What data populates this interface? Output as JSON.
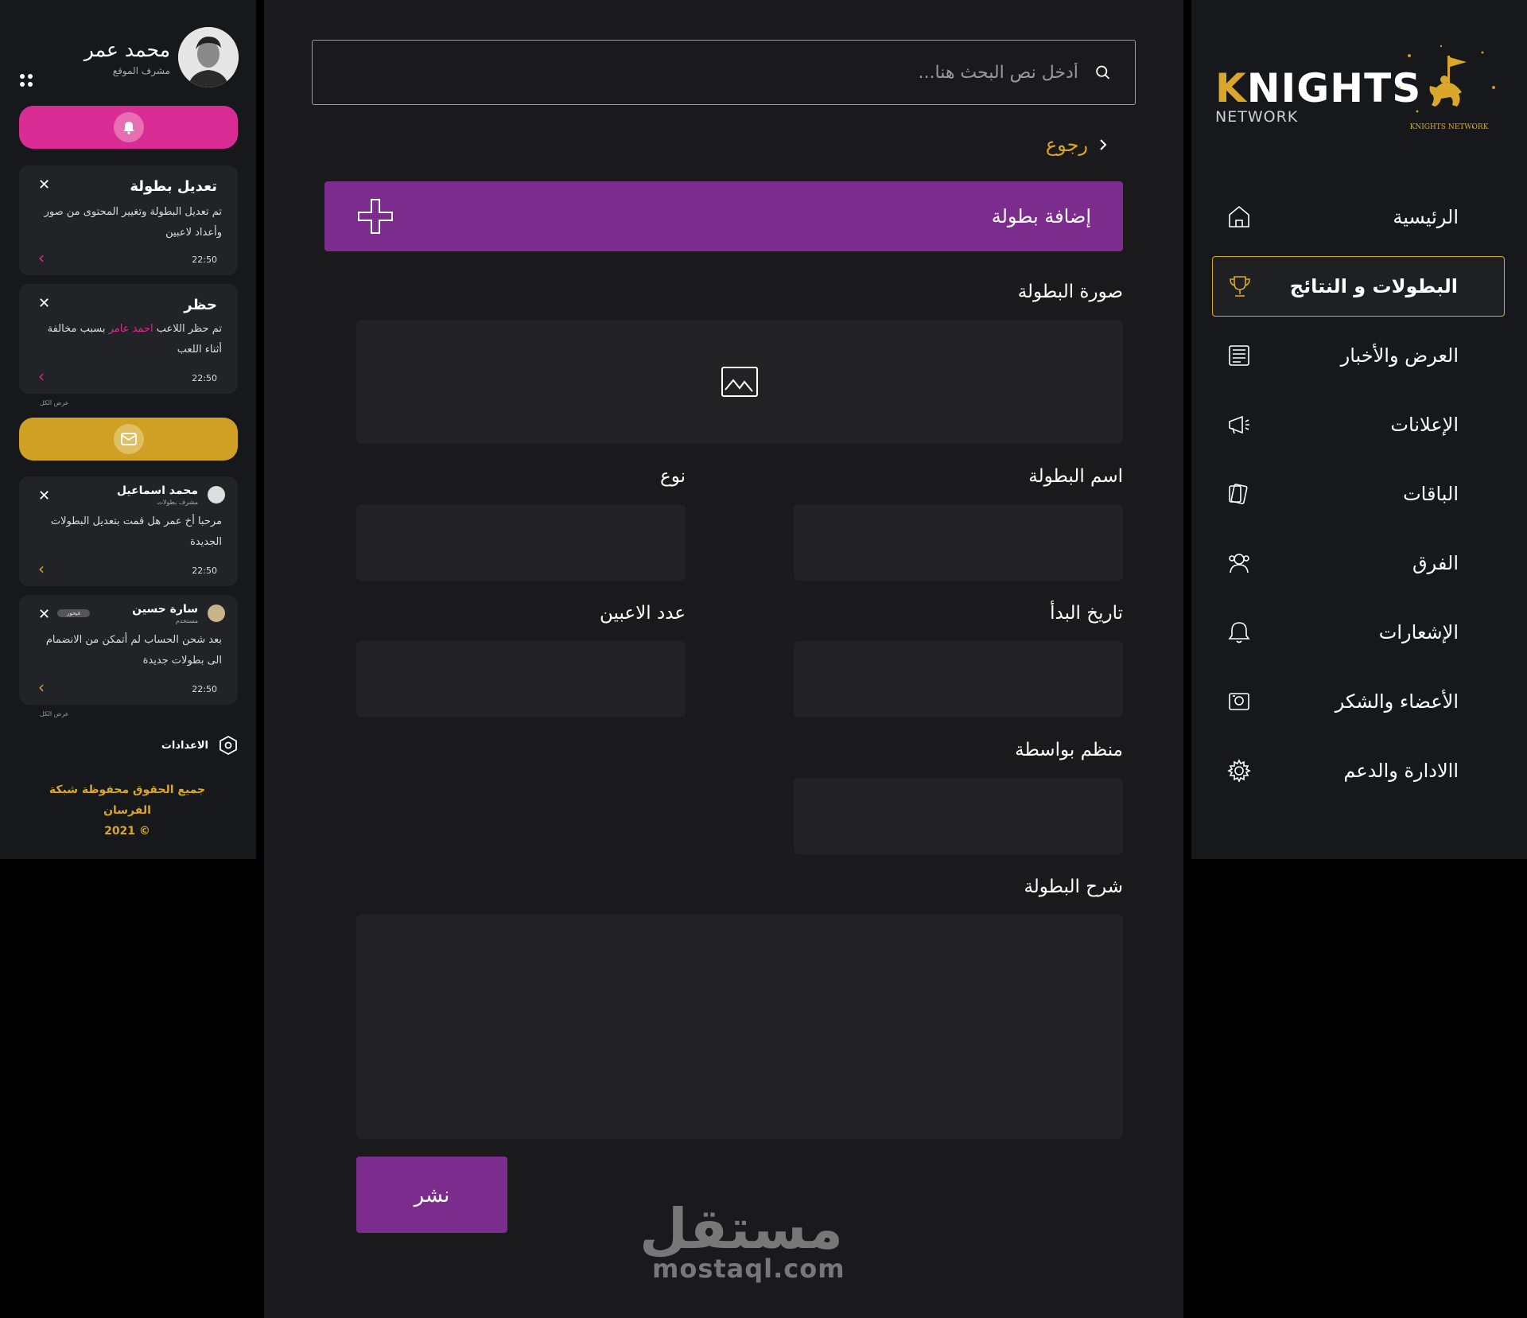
{
  "brand": {
    "logo_initial": "K",
    "logo_rest": "NIGHTS",
    "logo_sub": "NETWORK",
    "emblem_text": "KNIGHTS NETWORK"
  },
  "nav": [
    {
      "label": "الرئيسية",
      "icon": "home-icon"
    },
    {
      "label": "البطولات و النتائج",
      "icon": "trophy-icon",
      "active": true
    },
    {
      "label": "العرض والأخبار",
      "icon": "newspaper-icon"
    },
    {
      "label": "الإعلانات",
      "icon": "megaphone-icon"
    },
    {
      "label": "الباقات",
      "icon": "cards-icon"
    },
    {
      "label": "الفرق",
      "icon": "team-icon"
    },
    {
      "label": "الإشعارات",
      "icon": "bell-icon"
    },
    {
      "label": "الأعضاء والشكر",
      "icon": "members-icon"
    },
    {
      "label": "االادارة والدعم",
      "icon": "gear-icon"
    }
  ],
  "search": {
    "placeholder": "أدخل نص البحث هنا..."
  },
  "back_label": "رجوع",
  "form": {
    "title": "إضافة بطولة",
    "image_label": "صورة البطولة",
    "name_label": "اسم البطولة",
    "type_label": "نوع",
    "start_date_label": "تاريخ البدأ",
    "players_count_label": "عدد الاعبين",
    "organizer_label": "منظم بواسطة",
    "description_label": "شرح البطولة",
    "publish_label": "نشر"
  },
  "watermark": {
    "arabic": "مستقل",
    "latin": "mostaql.com"
  },
  "user": {
    "name": "محمد عمر",
    "role": "مشرف الموقع"
  },
  "notifications": [
    {
      "title": "تعديل بطولة",
      "body": "تم تعديل البطولة وتغيير المحتوى من صور وأعداد لاعبين",
      "time": "22:50"
    },
    {
      "title": "حظر",
      "body_before": "تم حظر اللاعب ",
      "highlight": "احمد عامر",
      "body_after": " بسبب مخالفة أثناء اللعب",
      "time": "22:50"
    }
  ],
  "see_all_label": "عرض الكل",
  "messages": [
    {
      "name": "محمد اسماعيل",
      "role": "مشرف بطولات",
      "body": "مرحبا أخ عمر هل قمت بتعديل البطولات الجديدة",
      "time": "22:50"
    },
    {
      "name": "سارة حسين",
      "role": "مستخدم",
      "tag": "فيحور",
      "body": "بعد شحن الحساب لم أتمكن من الانضمام الى بطولات جديدة",
      "time": "22:50"
    }
  ],
  "settings_label": "الاعدادات",
  "rights": {
    "line1": "جميع الحقوق محفوظة شبكة الفرسان",
    "line2": "© 2021"
  },
  "colors": {
    "gold": "#d9a82a",
    "purple": "#7b2c8c",
    "pink": "#d92d95"
  }
}
